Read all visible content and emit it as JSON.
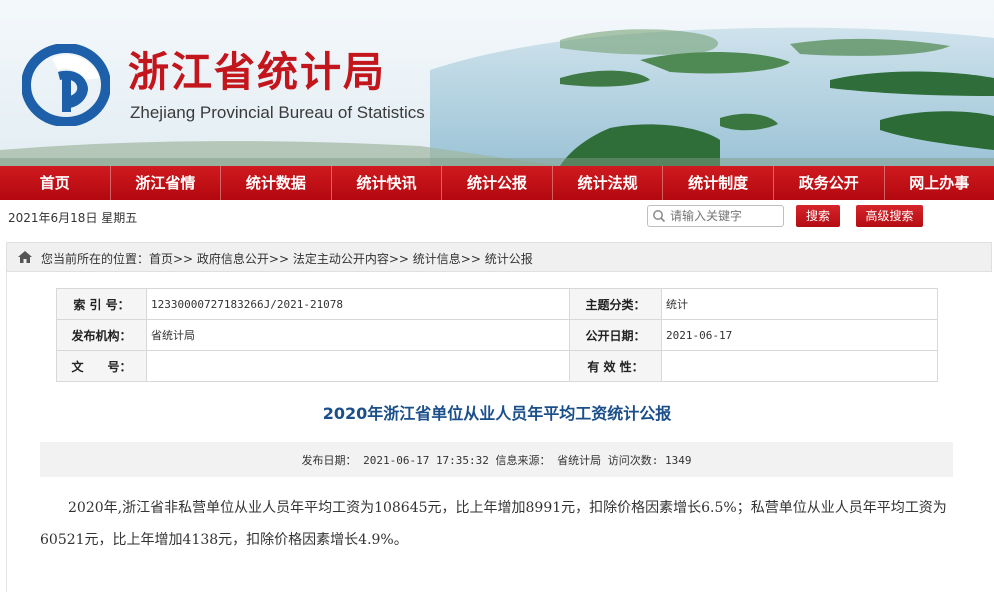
{
  "header": {
    "title": "浙江省统计局",
    "subtitle": "Zhejiang Provincial Bureau of Statistics",
    "logo_icon": "bureau-logo-icon",
    "brand_color": "#c3161c",
    "logo_color": "#1d5fa8"
  },
  "nav": {
    "items": [
      {
        "label": "首页"
      },
      {
        "label": "浙江省情"
      },
      {
        "label": "统计数据"
      },
      {
        "label": "统计快讯"
      },
      {
        "label": "统计公报"
      },
      {
        "label": "统计法规"
      },
      {
        "label": "统计制度"
      },
      {
        "label": "政务公开"
      },
      {
        "label": "网上办事"
      }
    ],
    "background_color": "#c0111a"
  },
  "toolbar": {
    "date": "2021年6月18日 星期五",
    "search_placeholder": "请输入关键字",
    "search_label": "搜索",
    "advanced_search_label": "高级搜索"
  },
  "breadcrumb": {
    "text": "您当前所在的位置：首页>> 政府信息公开>> 法定主动公开内容>> 统计信息>> 统计公报"
  },
  "meta": {
    "index_label": "索 引 号：",
    "index_value": "12330000727183266J/2021-21078",
    "category_label": "主题分类：",
    "category_value": "统计",
    "publisher_label": "发布机构：",
    "publisher_value": "省统计局",
    "open_date_label": "公开日期：",
    "open_date_value": "2021-06-17",
    "doc_no_label": "文　　号：",
    "doc_no_value": "",
    "validity_label": "有 效 性：",
    "validity_value": ""
  },
  "article": {
    "title": "2020年浙江省单位从业人员年平均工资统计公报",
    "info": "发布日期： 2021-06-17 17:35:32  信息来源： 省统计局 访问次数: 1349",
    "body": "2020年,浙江省非私营单位从业人员年平均工资为108645元，比上年增加8991元，扣除价格因素增长6.5%；私营单位从业人员年平均工资为60521元，比上年增加4138元，扣除价格因素增长4.9%。",
    "title_color": "#1b4f8a"
  }
}
